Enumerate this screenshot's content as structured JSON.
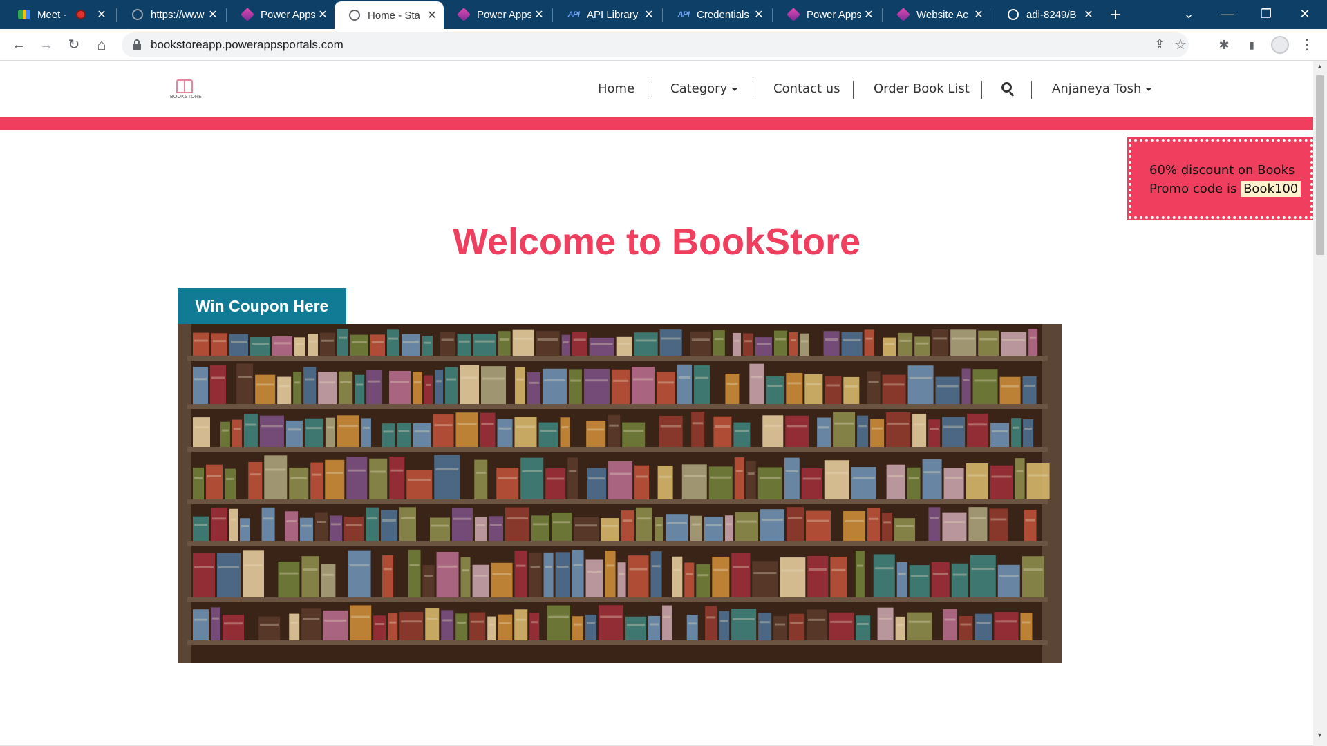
{
  "browser": {
    "tabs": [
      {
        "title": "Meet -",
        "favicon": "google-meet-icon",
        "recording": true
      },
      {
        "title": "https://www",
        "favicon": "globe-icon"
      },
      {
        "title": "Power Apps",
        "favicon": "power-apps-icon"
      },
      {
        "title": "Home - Sta",
        "favicon": "globe-icon",
        "active": true
      },
      {
        "title": "Power Apps",
        "favicon": "power-apps-icon"
      },
      {
        "title": "API Library",
        "favicon": "api-icon"
      },
      {
        "title": "Credentials",
        "favicon": "api-icon"
      },
      {
        "title": "Power Apps",
        "favicon": "power-apps-icon"
      },
      {
        "title": "Website Ac",
        "favicon": "power-apps-icon"
      },
      {
        "title": "adi-8249/B",
        "favicon": "github-icon"
      }
    ],
    "api_badge": "API",
    "url": "bookstoreapp.powerappsportals.com",
    "icons": {
      "close": "✕",
      "new_tab": "+",
      "back": "←",
      "forward": "→",
      "reload": "↻",
      "home": "⌂",
      "share": "⇪",
      "star": "☆",
      "extensions": "✱",
      "sidepanel": "▮",
      "menu": "⋮",
      "minimize": "—",
      "restore": "❐",
      "window_close": "✕",
      "tab_search": "⌄"
    }
  },
  "site": {
    "logo_text": "BOOKSTORE",
    "nav": {
      "home": "Home",
      "category": "Category",
      "contact": "Contact us",
      "orders": "Order Book List",
      "user": "Anjaneya Tosh"
    },
    "promo": {
      "line1": "60% discount on Books",
      "line2": "Promo code is",
      "code": "Book100"
    },
    "welcome": "Welcome to BookStore",
    "coupon_button": "Win Coupon Here",
    "colors": {
      "brand_pink": "#ef3e5e",
      "coupon_teal": "#117a94",
      "tabstrip": "#0e3f66"
    }
  }
}
